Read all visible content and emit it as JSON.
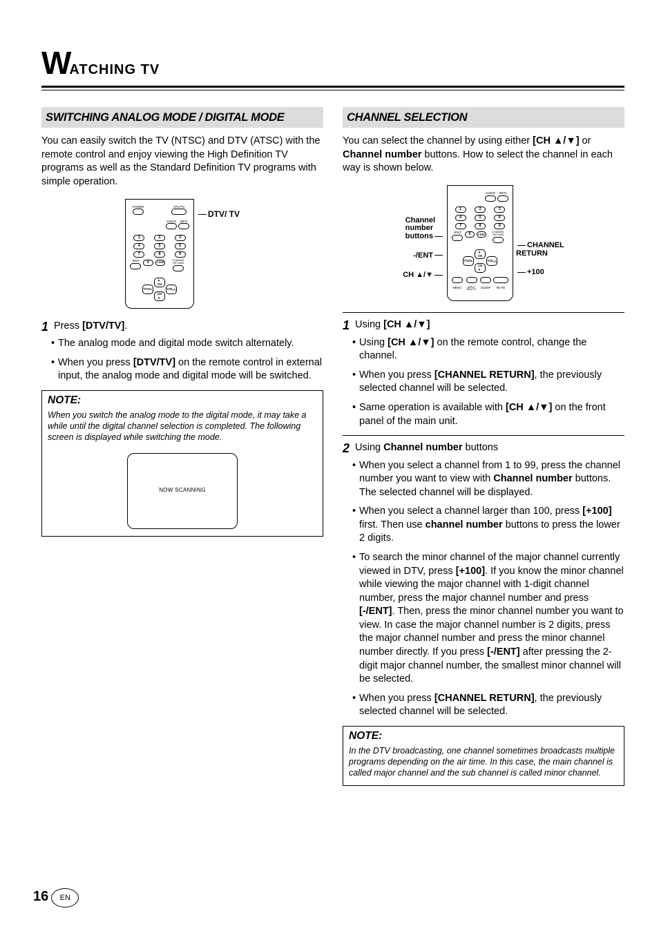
{
  "page_title_initial": "W",
  "page_title_rest": "ATCHING TV",
  "left": {
    "heading": "SWITCHING ANALOG MODE / DIGITAL MODE",
    "intro": "You can easily switch the TV (NTSC) and DTV (ATSC) with the remote control and enjoy viewing the High Definition TV programs as well as the Standard Definition TV programs with simple operation.",
    "remote_callout": "DTV/ TV",
    "remote": {
      "power": "POWER",
      "dtvtv": "DTV/TV",
      "audio": "AUDIO",
      "info": "INFO",
      "ent": "-/ENT",
      "plus100": "+100",
      "chret": "CHANNEL RETURN",
      "vol": "VOL",
      "ch": "CH"
    },
    "step1_label": "1",
    "step1_pre": "Press ",
    "step1_key": "[DTV/TV]",
    "step1_post": ".",
    "bullets": [
      {
        "text_a": "The analog mode and digital mode switch alternately."
      },
      {
        "text_a": "When you press ",
        "bold": "[DTV/TV]",
        "text_b": " on the remote control in external input, the analog mode and digital mode will be switched."
      }
    ],
    "note_title": "NOTE:",
    "note_text": "When you switch the analog mode to the digital mode, it may take a while until the digital channel selection is completed. The following screen is displayed while switching the mode.",
    "screen_text": "NOW SCANNING"
  },
  "right": {
    "heading": "CHANNEL SELECTION",
    "intro_a": "You can select the channel by using either ",
    "intro_key": "[CH ▲/▼]",
    "intro_b": " or ",
    "intro_bold": "Channel number",
    "intro_c": " buttons. How to select the channel in each way is shown below.",
    "callouts": {
      "cnb": "Channel\nnumber\nbuttons",
      "ent": "-/ENT",
      "chud": "CH ▲/▼",
      "chret": "CHANNEL\nRETURN",
      "p100": "+100"
    },
    "remote": {
      "audio": "AUDIO",
      "info": "INFO",
      "ent": "-/ENT",
      "plus100": "+100",
      "chret": "CHANNEL RETURN",
      "vol": "VOL",
      "ch": "CH",
      "menu": "MENU",
      "input": "INPUT SELECT",
      "sleep": "SLEEP",
      "mute": "MUTE"
    },
    "step1_label": "1",
    "step1_pre": "Using ",
    "step1_key": "[CH ▲/▼]",
    "s1_bullets": [
      {
        "a": "Using ",
        "k": "[CH ▲/▼]",
        "b": " on the remote control, change the channel."
      },
      {
        "a": "When you press ",
        "k": "[CHANNEL RETURN]",
        "b": ", the previously selected channel will be selected."
      },
      {
        "a": "Same operation is available with ",
        "k": "[CH ▲/▼]",
        "b": " on the front panel of the main unit."
      }
    ],
    "step2_label": "2",
    "step2_pre": "Using ",
    "step2_bold": "Channel number",
    "step2_post": " buttons",
    "s2_bullets": [
      {
        "a": "When you select a channel from 1 to 99, press the channel number you want to view with ",
        "k": "Channel number",
        "b": " buttons. The selected channel will be displayed."
      },
      {
        "a": "When you select a channel larger than 100, press ",
        "k": "[+100]",
        "b": " first. Then use ",
        "k2": "channel number",
        "c": " buttons to press the lower 2 digits."
      },
      {
        "a": "To search the minor channel of the major channel currently viewed in DTV, press ",
        "k": "[+100]",
        "b": ". If you know the minor channel while viewing the major channel with 1-digit channel number, press the major channel number and press ",
        "k2": "[-/ENT]",
        "c": ". Then, press the minor channel number you want to view. In case the major channel number is 2 digits, press the major channel number and press the minor channel number directly. If you press ",
        "k3": "[-/ENT]",
        "d": " after pressing the 2-digit major channel number, the smallest minor channel will be selected."
      },
      {
        "a": "When you press ",
        "k": "[CHANNEL RETURN]",
        "b": ", the previously selected channel will be selected."
      }
    ],
    "note_title": "NOTE:",
    "note_text": "In the DTV broadcasting, one channel sometimes broadcasts multiple programs depending on the air time. In this case, the main channel is called major channel and the sub channel is called minor channel."
  },
  "page_number": "16",
  "page_lang": "EN"
}
